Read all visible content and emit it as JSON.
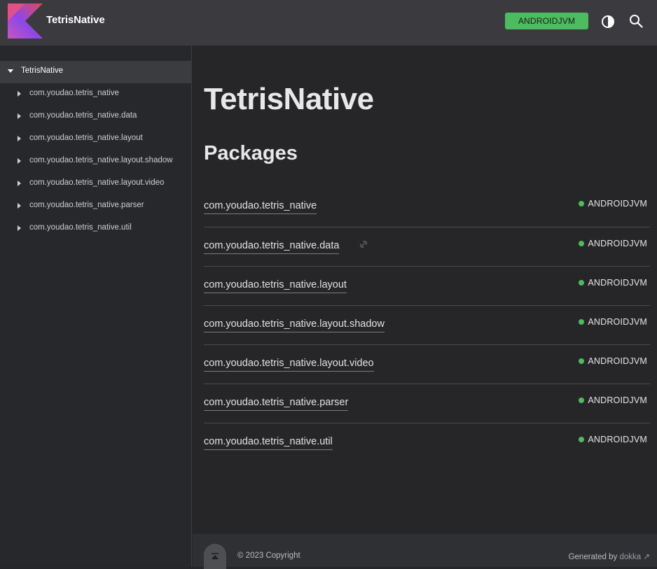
{
  "header": {
    "title": "TetrisNative",
    "platform_label": "ANDROIDJVM"
  },
  "sidebar": {
    "root_label": "TetrisNative",
    "items": [
      {
        "label": "com.youdao.tetris_native"
      },
      {
        "label": "com.youdao.tetris_native.data"
      },
      {
        "label": "com.youdao.tetris_native.layout"
      },
      {
        "label": "com.youdao.tetris_native.layout.shadow"
      },
      {
        "label": "com.youdao.tetris_native.layout.video"
      },
      {
        "label": "com.youdao.tetris_native.parser"
      },
      {
        "label": "com.youdao.tetris_native.util"
      }
    ]
  },
  "main": {
    "title": "TetrisNative",
    "section_title": "Packages",
    "packages": [
      {
        "name": "com.youdao.tetris_native",
        "platform": "ANDROIDJVM"
      },
      {
        "name": "com.youdao.tetris_native.data",
        "platform": "ANDROIDJVM"
      },
      {
        "name": "com.youdao.tetris_native.layout",
        "platform": "ANDROIDJVM"
      },
      {
        "name": "com.youdao.tetris_native.layout.shadow",
        "platform": "ANDROIDJVM"
      },
      {
        "name": "com.youdao.tetris_native.layout.video",
        "platform": "ANDROIDJVM"
      },
      {
        "name": "com.youdao.tetris_native.parser",
        "platform": "ANDROIDJVM"
      },
      {
        "name": "com.youdao.tetris_native.util",
        "platform": "ANDROIDJVM"
      }
    ]
  },
  "footer": {
    "copyright": "© 2023 Copyright",
    "generated_by": "Generated by ",
    "generator": "dokka",
    "generator_arrow": "↗"
  },
  "icons": {
    "logo": "kotlin-logo-icon",
    "theme": "contrast-icon",
    "search": "search-icon",
    "anchor": "link-icon",
    "scroll_top": "arrow-up-to-line-icon"
  },
  "colors": {
    "accent_green": "#4dbb5f",
    "header_bg": "#3b3b3f",
    "page_bg": "#262628"
  }
}
